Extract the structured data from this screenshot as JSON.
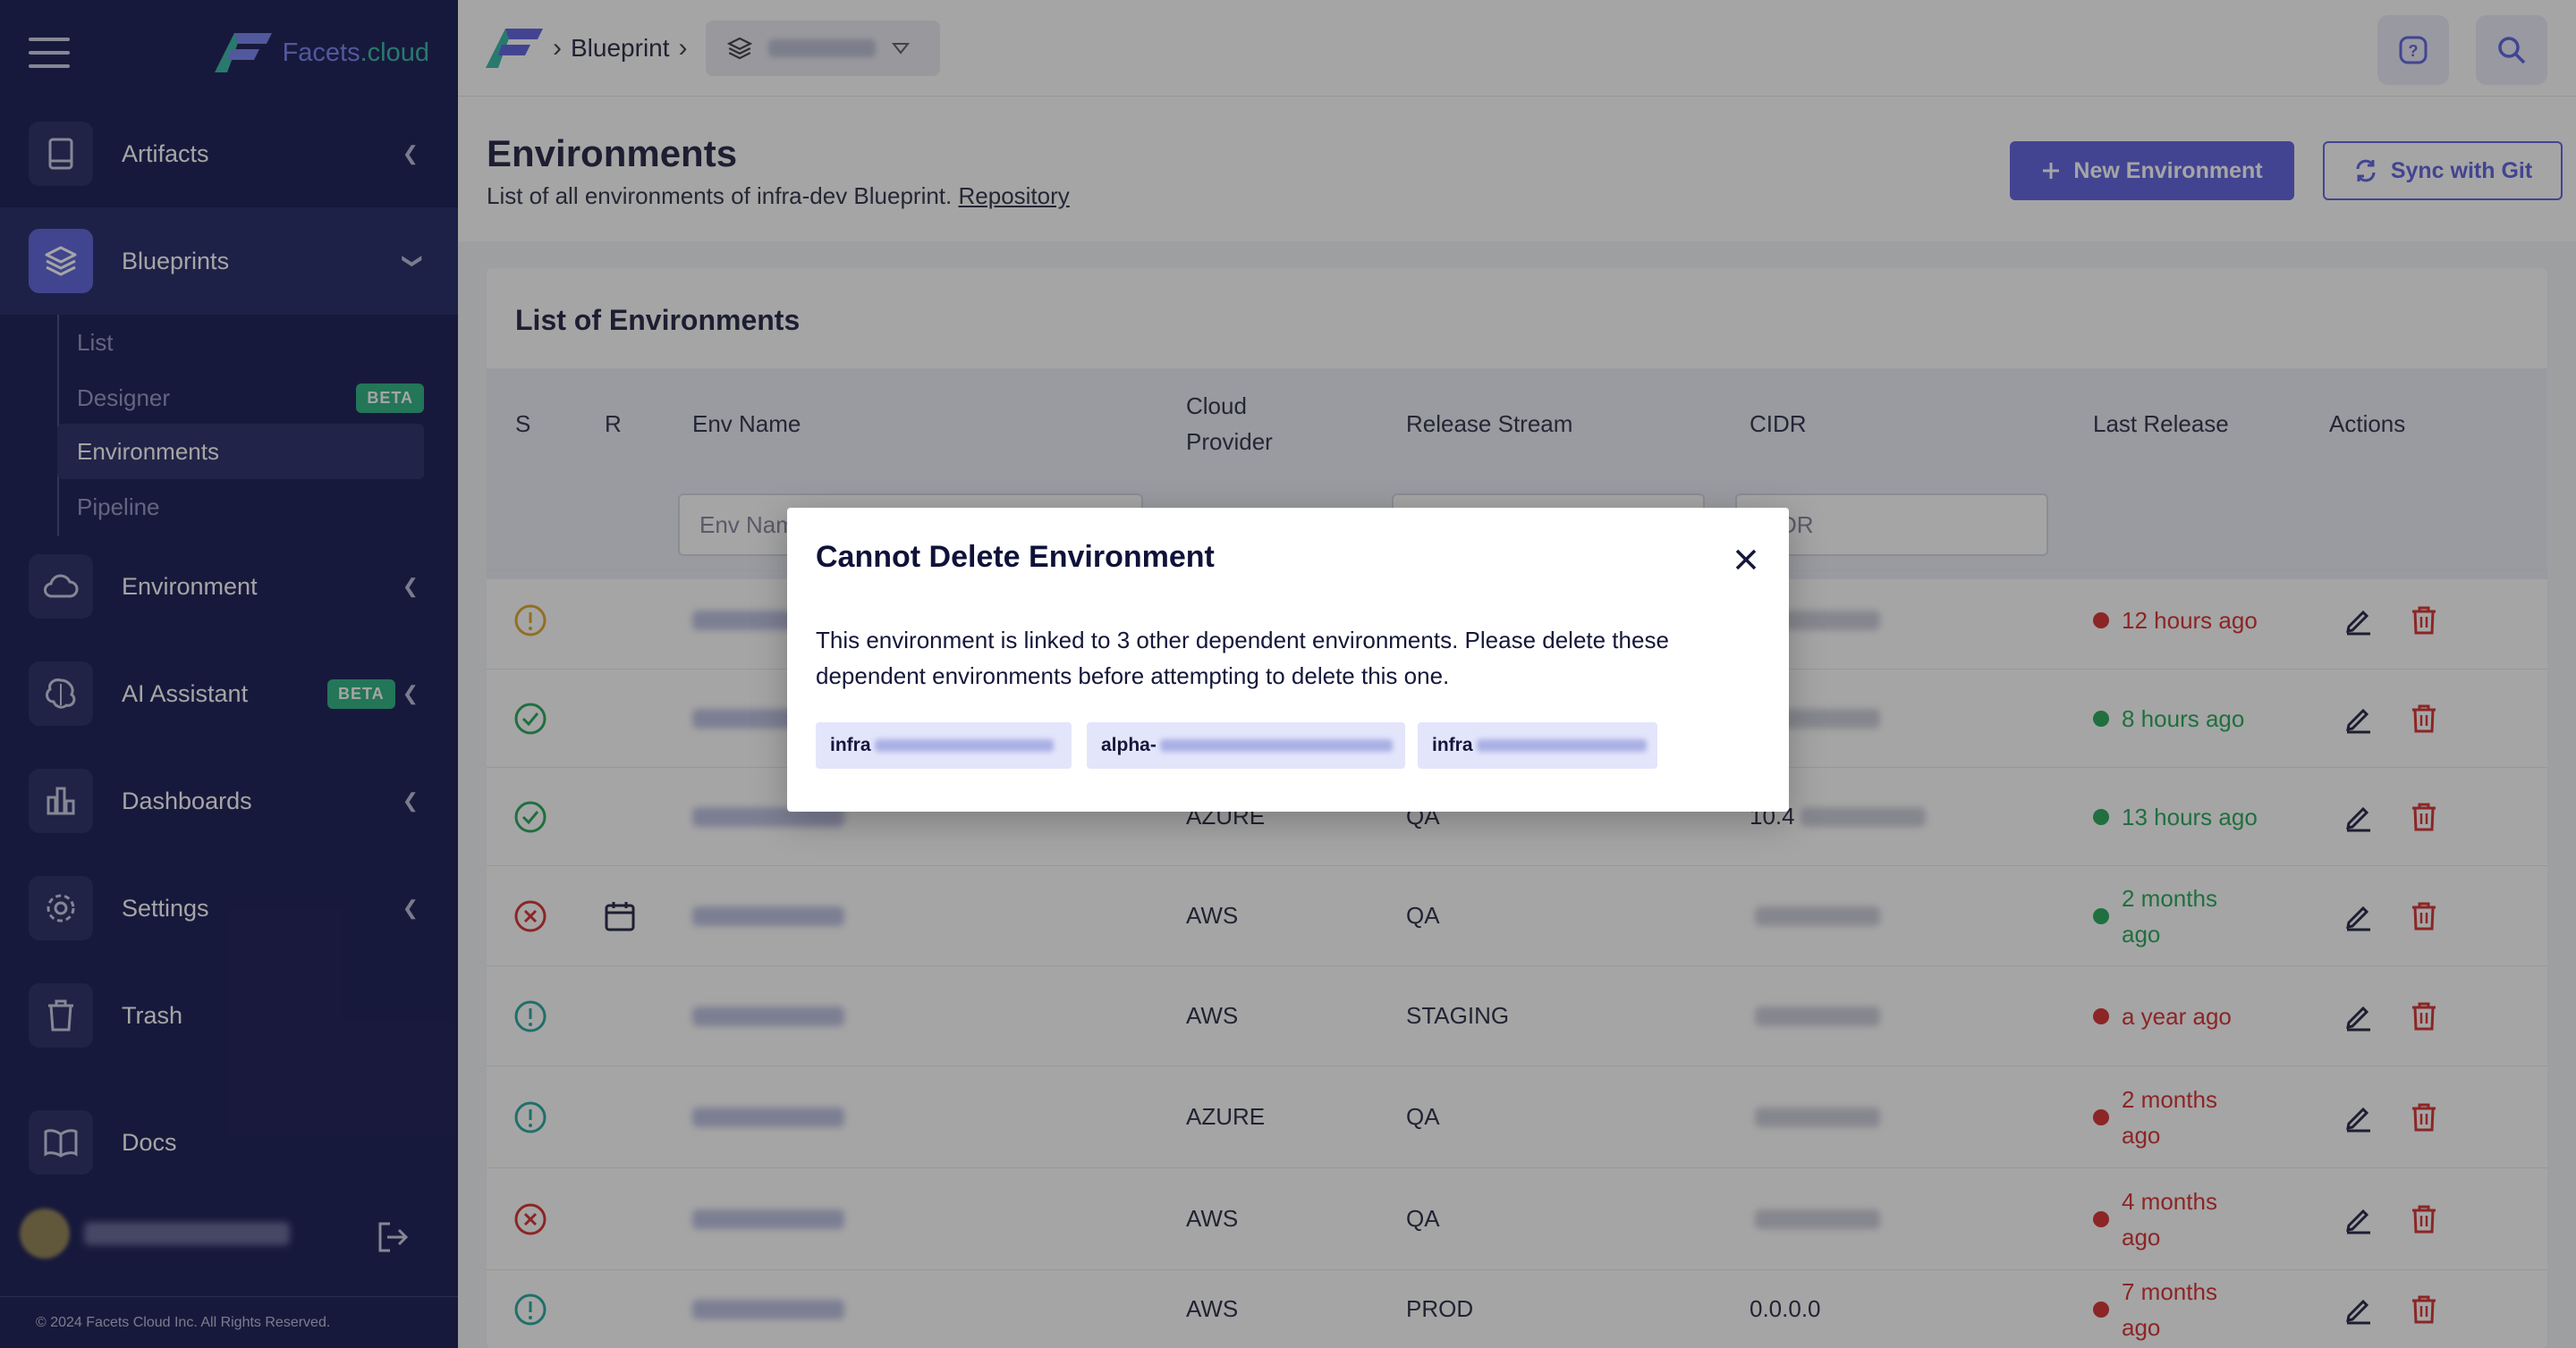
{
  "brand": {
    "name_part1": "Facets",
    "name_part2": ".cloud"
  },
  "sidebar": {
    "items": [
      {
        "label": "Artifacts"
      },
      {
        "label": "Blueprints"
      },
      {
        "label": "Environment"
      },
      {
        "label": "AI Assistant",
        "badge": "BETA"
      },
      {
        "label": "Dashboards"
      },
      {
        "label": "Settings"
      },
      {
        "label": "Trash"
      },
      {
        "label": "Docs"
      }
    ],
    "sub_items": [
      {
        "label": "List"
      },
      {
        "label": "Designer",
        "badge": "BETA"
      },
      {
        "label": "Environments"
      },
      {
        "label": "Pipeline"
      }
    ],
    "footer": "© 2024 Facets Cloud Inc. All Rights Reserved."
  },
  "topbar": {
    "breadcrumb": "Blueprint"
  },
  "page": {
    "title": "Environments",
    "subtitle": "List of all environments of infra-dev Blueprint.",
    "repo_link": "Repository",
    "new_env_label": "New Environment",
    "sync_label": "Sync with Git"
  },
  "table": {
    "card_title": "List of Environments",
    "headers": {
      "s": "S",
      "r": "R",
      "env_name": "Env Name",
      "cloud_provider_1": "Cloud",
      "cloud_provider_2": "Provider",
      "release_stream": "Release Stream",
      "cidr": "CIDR",
      "last_release": "Last Release",
      "actions": "Actions"
    },
    "filters": {
      "env_name_placeholder": "Env Name",
      "cidr_placeholder": "CIDR"
    },
    "rows": [
      {
        "status": "warning",
        "cloud": "",
        "stream": "",
        "cidr": "",
        "last1": "12 hours ago",
        "last2": "",
        "color": "red"
      },
      {
        "status": "success",
        "cloud": "",
        "stream": "",
        "cidr": "",
        "last1": "8 hours ago",
        "last2": "",
        "color": "green"
      },
      {
        "status": "success",
        "cloud": "AZURE",
        "stream": "QA",
        "cidr": "10.4",
        "last1": "13 hours ago",
        "last2": "",
        "color": "green"
      },
      {
        "status": "failed",
        "cloud": "AWS",
        "stream": "QA",
        "cidr": "",
        "last1": "2 months",
        "last2": "ago",
        "color": "green",
        "scheduled": true
      },
      {
        "status": "info",
        "cloud": "AWS",
        "stream": "STAGING",
        "cidr": "",
        "last1": "a year ago",
        "last2": "",
        "color": "red"
      },
      {
        "status": "info",
        "cloud": "AZURE",
        "stream": "QA",
        "cidr": "",
        "last1": "2 months",
        "last2": "ago",
        "color": "red"
      },
      {
        "status": "failed",
        "cloud": "AWS",
        "stream": "QA",
        "cidr": "",
        "last1": "4 months",
        "last2": "ago",
        "color": "red"
      },
      {
        "status": "info",
        "cloud": "AWS",
        "stream": "PROD",
        "cidr": "0.0.0.0",
        "last1": "7 months",
        "last2": "ago",
        "color": "red"
      }
    ]
  },
  "modal": {
    "title": "Cannot Delete Environment",
    "body": "This environment is linked to 3 other dependent environments. Please delete these dependent environments before attempting to delete this one.",
    "chips": [
      {
        "prefix": "infra"
      },
      {
        "prefix": "alpha-"
      },
      {
        "prefix": "infra"
      }
    ]
  },
  "colors": {
    "sidebar_bg": "#0c0f4a",
    "accent": "#5559df",
    "danger": "#d42323",
    "success": "#1aa350",
    "warning": "#e0a020",
    "info": "#1aa39a"
  }
}
